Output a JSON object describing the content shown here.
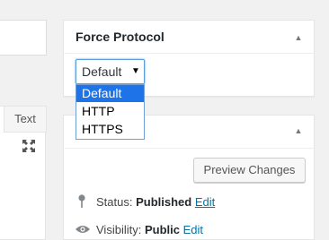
{
  "editor": {
    "text_tab_label": "Text"
  },
  "force_protocol_box": {
    "title": "Force Protocol",
    "select": {
      "value": "Default",
      "options": [
        "Default",
        "HTTP",
        "HTTPS"
      ],
      "selected_index": 0
    }
  },
  "publish_box": {
    "preview_button": "Preview Changes",
    "status": {
      "label": "Status:",
      "value": "Published",
      "edit": "Edit"
    },
    "visibility": {
      "label": "Visibility:",
      "value": "Public",
      "edit": "Edit"
    }
  },
  "colors": {
    "accent": "#0073aa",
    "selected_option": "#1e73e8"
  }
}
